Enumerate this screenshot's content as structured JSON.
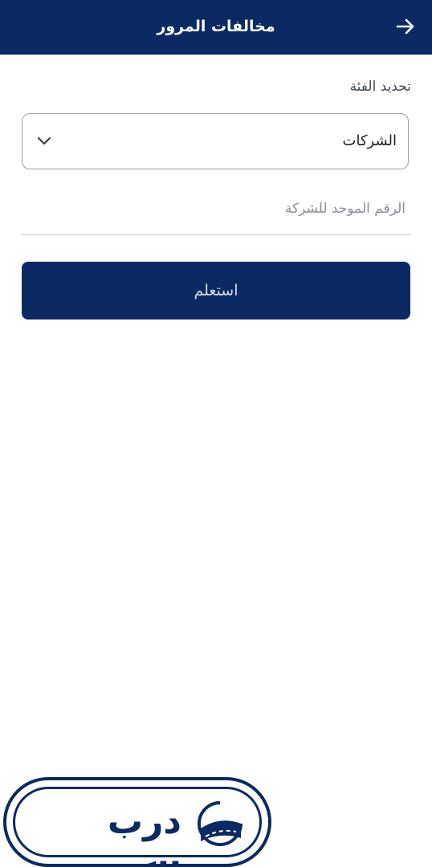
{
  "header": {
    "title": "مخالفات المرور",
    "back_icon": "arrow-right-icon"
  },
  "form": {
    "category_label": "تحديد الفئة",
    "category_selected": "الشركات",
    "dropdown_icon": "chevron-down-icon",
    "company_id_placeholder": "الرقم الموحد للشركة",
    "company_id_value": "",
    "submit_label": "استعلم"
  },
  "footer": {
    "brand_text": "درب الكويت",
    "emblem_icon": "road-icon"
  },
  "colors": {
    "primary": "#0b2a63",
    "button_text": "#d9dde6",
    "border": "#9aa0a6"
  }
}
